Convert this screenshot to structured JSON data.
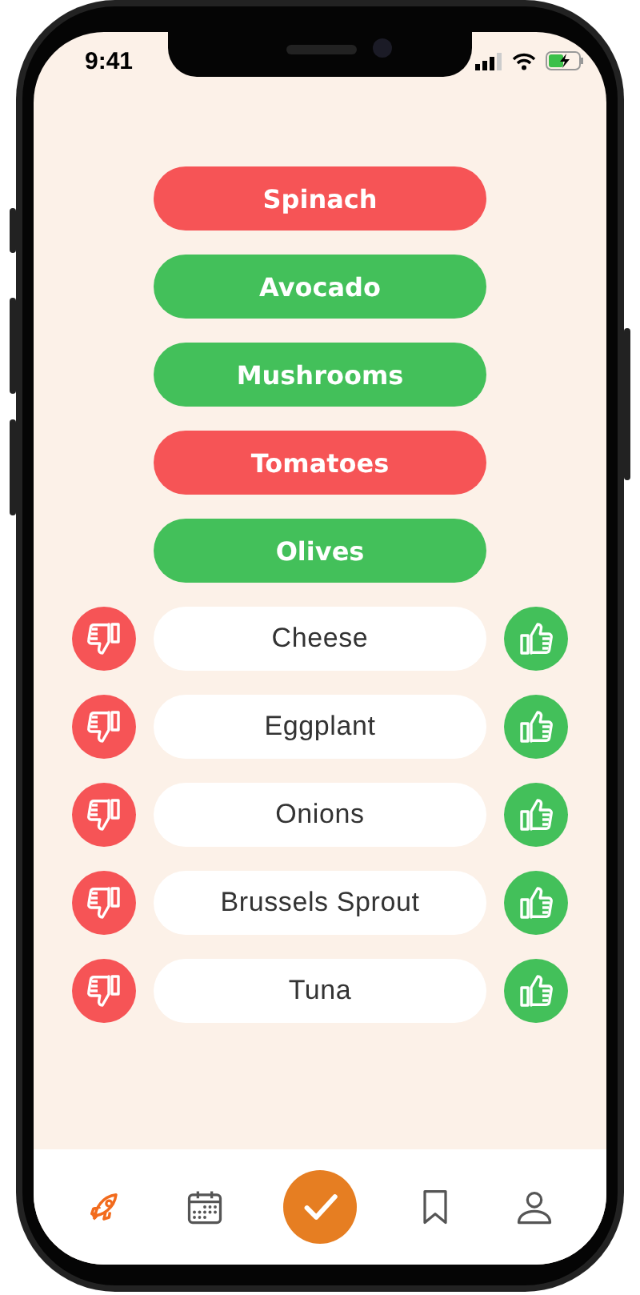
{
  "status_bar": {
    "time": "9:41"
  },
  "voted": [
    {
      "label": "Spinach",
      "kind": "dislike"
    },
    {
      "label": "Avocado",
      "kind": "like"
    },
    {
      "label": "Mushrooms",
      "kind": "like"
    },
    {
      "label": "Tomatoes",
      "kind": "dislike"
    },
    {
      "label": "Olives",
      "kind": "like"
    }
  ],
  "pending": [
    {
      "label": "Cheese"
    },
    {
      "label": "Eggplant"
    },
    {
      "label": "Onions"
    },
    {
      "label": "Brussels Sprout"
    },
    {
      "label": "Tuna"
    }
  ],
  "nav": [
    {
      "kind": "rocket",
      "selected": true
    },
    {
      "kind": "calendar",
      "selected": false
    },
    {
      "kind": "check",
      "selected": false
    },
    {
      "kind": "bookmark",
      "selected": false
    },
    {
      "kind": "profile",
      "selected": false
    }
  ]
}
